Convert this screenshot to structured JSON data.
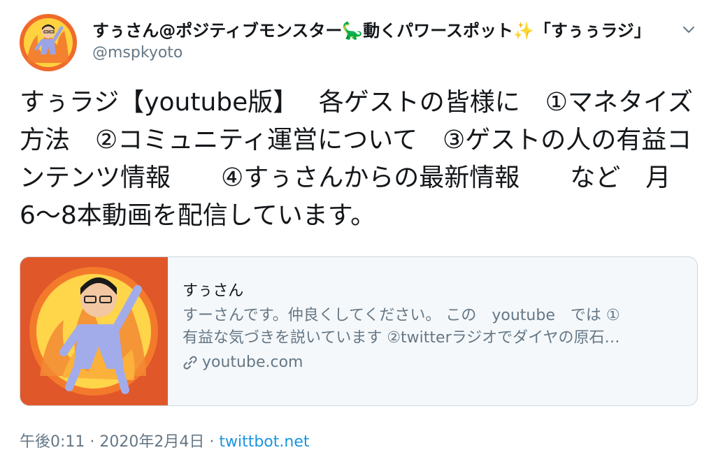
{
  "user": {
    "display_name": "すぅさん@ポジティブモンスター🦕動くパワースポット✨「すぅぅラジ」",
    "handle": "@mspkyoto",
    "avatar_icon": "profile-avatar-icon"
  },
  "tweet": {
    "text": "すぅラジ【youtube版】　 各ゲストの皆様に　①マネタイズ方法　②コミュニティ運営について　③ゲストの人の有益コンテンツ情報　　④すぅさんからの最新情報　　など　月6〜8本動画を配信しています。"
  },
  "card": {
    "title": "すぅさん",
    "description_line1": "すーさんです。仲良くしてください。 この　youtube　では ①",
    "description_line2": "有益な気づきを説いています ②twitterラジオでダイヤの原石…",
    "domain": "youtube.com",
    "link_icon": "link-icon",
    "media_icon": "channel-thumbnail-icon"
  },
  "meta": {
    "time": "午後0:11",
    "sep1": " · ",
    "date": "2020年2月4日",
    "sep2": " · ",
    "source": "twittbot.net"
  },
  "colors": {
    "text": "#14171a",
    "secondary": "#657786",
    "link": "#1b95e0",
    "border": "#ccd6dd",
    "card_bg": "#f5f8fa"
  }
}
